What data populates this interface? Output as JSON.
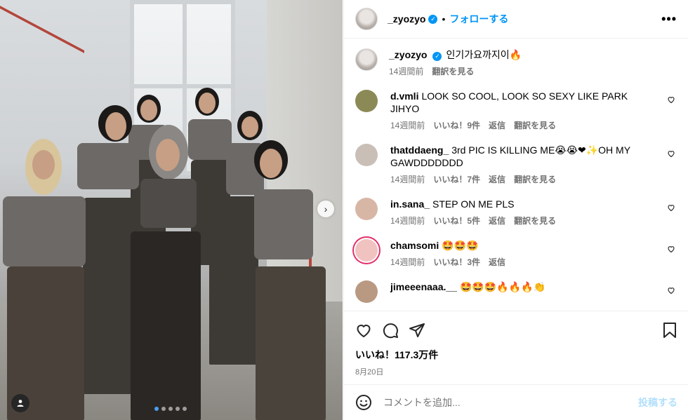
{
  "header": {
    "username": "_zyozyo",
    "separator": "•",
    "follow_label": "フォローする",
    "more_label": "•••"
  },
  "caption": {
    "username": "_zyozyo",
    "text": "인기가요까지이🔥",
    "time": "14週間前",
    "translate": "翻訳を見る"
  },
  "comments": [
    {
      "username": "d.vmli",
      "text": "LOOK SO COOL, LOOK SO SEXY LIKE PARK JIHYO",
      "time": "14週間前",
      "likes": "いいね！9件",
      "reply": "返信",
      "translate": "翻訳を見る",
      "avatar_color": "#8b8a56"
    },
    {
      "username": "thatddaeng_",
      "text": "3rd PIC IS KILLING ME😭😭❤✨OH MY GAWDDDDDDD",
      "time": "14週間前",
      "likes": "いいね！7件",
      "reply": "返信",
      "translate": "翻訳を見る",
      "avatar_color": "#c9bfb6"
    },
    {
      "username": "in.sana_",
      "text": "STEP ON ME PLS",
      "time": "14週間前",
      "likes": "いいね！5件",
      "reply": "返信",
      "translate": "翻訳を見る",
      "avatar_color": "#d8b6a6"
    },
    {
      "username": "chamsomi",
      "text": "🤩🤩🤩",
      "time": "14週間前",
      "likes": "いいね！3件",
      "reply": "返信",
      "translate": "",
      "avatar_color": "#f1c3c0"
    },
    {
      "username": "jimeeenaaa.__",
      "text": "🤩🤩🤩🔥🔥🔥👏",
      "time": "",
      "likes": "",
      "reply": "",
      "translate": "",
      "avatar_color": "#b99982"
    }
  ],
  "footer": {
    "likes_count": "いいね！117.3万件",
    "date": "8月20日",
    "comment_placeholder": "コメントを追加...",
    "post_label": "投稿する"
  },
  "carousel": {
    "total": 5,
    "active_index": 0
  },
  "colors": {
    "accent": "#0095f6",
    "verified": "#0095f6",
    "post_disabled": "#b2dffc"
  },
  "icons": [
    "heart-icon",
    "comment-icon",
    "share-icon",
    "bookmark-icon",
    "emoji-icon",
    "chevron-right-icon",
    "user-tag-icon",
    "verified-icon"
  ]
}
